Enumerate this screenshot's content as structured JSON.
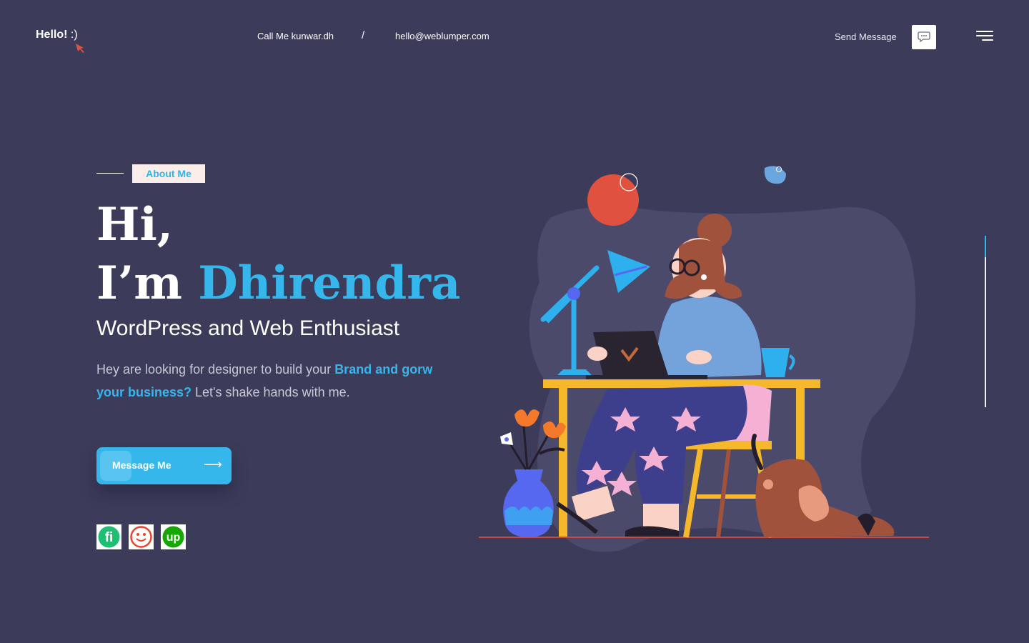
{
  "header": {
    "logo_text": "Hello!",
    "logo_smile": ":)",
    "phone_text": "Call Me kunwar.dh",
    "separator": "/",
    "email_text": "hello@weblumper.com",
    "send_message_label": "Send Message",
    "chat_icon": "chat-bubble-icon",
    "menu_icon": "hamburger-menu-icon"
  },
  "hero": {
    "tag_label": "About Me",
    "greeting": "Hi,",
    "intro_prefix": "I’m ",
    "name": "Dhirendra",
    "subtitle": "WordPress and Web Enthusiast",
    "description_start": "Hey are looking for designer to build your ",
    "description_highlight": "Brand and gorw your business?",
    "description_end": " Let's shake hands with me.",
    "cta_label": "Message Me",
    "cta_icon": "arrow-right-icon"
  },
  "social": [
    {
      "name": "fiverr",
      "icon": "fiverr-icon",
      "color": "#1dbf73"
    },
    {
      "name": "freelancer",
      "icon": "freelancer-icon",
      "color": "#e8452b"
    },
    {
      "name": "upwork",
      "icon": "upwork-icon",
      "color": "#14a800"
    }
  ],
  "colors": {
    "background": "#3c3b5a",
    "accent": "#35b7ec",
    "tag_background": "#fbeeea"
  }
}
